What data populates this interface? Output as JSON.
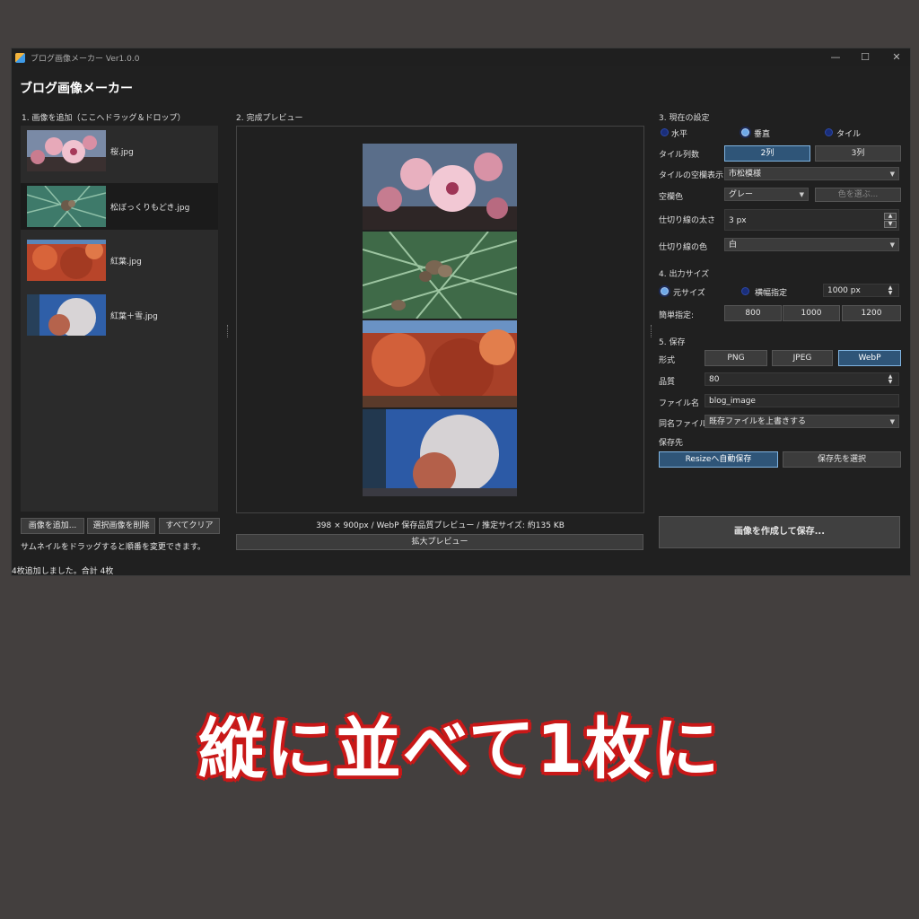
{
  "window": {
    "title": "ブログ画像メーカー Ver1.0.0",
    "heading": "ブログ画像メーカー",
    "controls": {
      "minimize": "—",
      "maximize": "☐",
      "close": "✕"
    }
  },
  "left": {
    "section_title": "1. 画像を追加（ここへドラッグ＆ドロップ）",
    "files": [
      {
        "name": "桜.jpg"
      },
      {
        "name": "松ぼっくりもどき.jpg"
      },
      {
        "name": "紅葉.jpg"
      },
      {
        "name": "紅葉＋雪.jpg"
      }
    ],
    "add_button": "画像を追加...",
    "remove_button": "選択画像を削除",
    "clear_button": "すべてクリア",
    "hint": "サムネイルをドラッグすると順番を変更できます。"
  },
  "center": {
    "section_title": "2. 完成プレビュー",
    "info": "398 × 900px / WebP 保存品質プレビュー / 推定サイズ: 約135 KB",
    "zoom_button": "拡大プレビュー"
  },
  "settings": {
    "section_title": "3. 現在の設定",
    "layout_options": [
      "水平",
      "垂直",
      "タイル"
    ],
    "layout_selected": "垂直",
    "tile_cols_label": "タイル列数",
    "tile_cols": [
      "2列",
      "3列"
    ],
    "tile_empty_label": "タイルの空欄表示",
    "tile_empty_value": "市松模様",
    "blank_color_label": "空欄色",
    "blank_color_value": "グレー",
    "choose_color_button": "色を選ぶ...",
    "divider_width_label": "仕切り線の太さ",
    "divider_width_value": "3 px",
    "divider_color_label": "仕切り線の色",
    "divider_color_value": "白"
  },
  "output": {
    "section_title": "4. 出力サイズ",
    "original_label": "元サイズ",
    "width_label": "横幅指定",
    "width_value": "1000 px",
    "quick_label": "簡単指定:",
    "quick": [
      "800",
      "1000",
      "1200"
    ]
  },
  "save": {
    "section_title": "5. 保存",
    "format_label": "形式",
    "formats": [
      "PNG",
      "JPEG",
      "WebP"
    ],
    "format_selected": "WebP",
    "quality_label": "品質",
    "quality_value": "80",
    "filename_label": "ファイル名",
    "filename_value": "blog_image",
    "samename_label": "同名ファイル",
    "samename_value": "既存ファイルを上書きする",
    "dest_label": "保存先",
    "auto_save_button": "Resizeへ自動保存",
    "choose_dest_button": "保存先を選択",
    "create_button": "画像を作成して保存..."
  },
  "status": "4枚追加しました。合計 4枚",
  "caption": "縦に並べて1枚に",
  "colors": {
    "accent_blue": "#2f5578",
    "background": "#433f3e",
    "caption_outline": "#c81818"
  }
}
